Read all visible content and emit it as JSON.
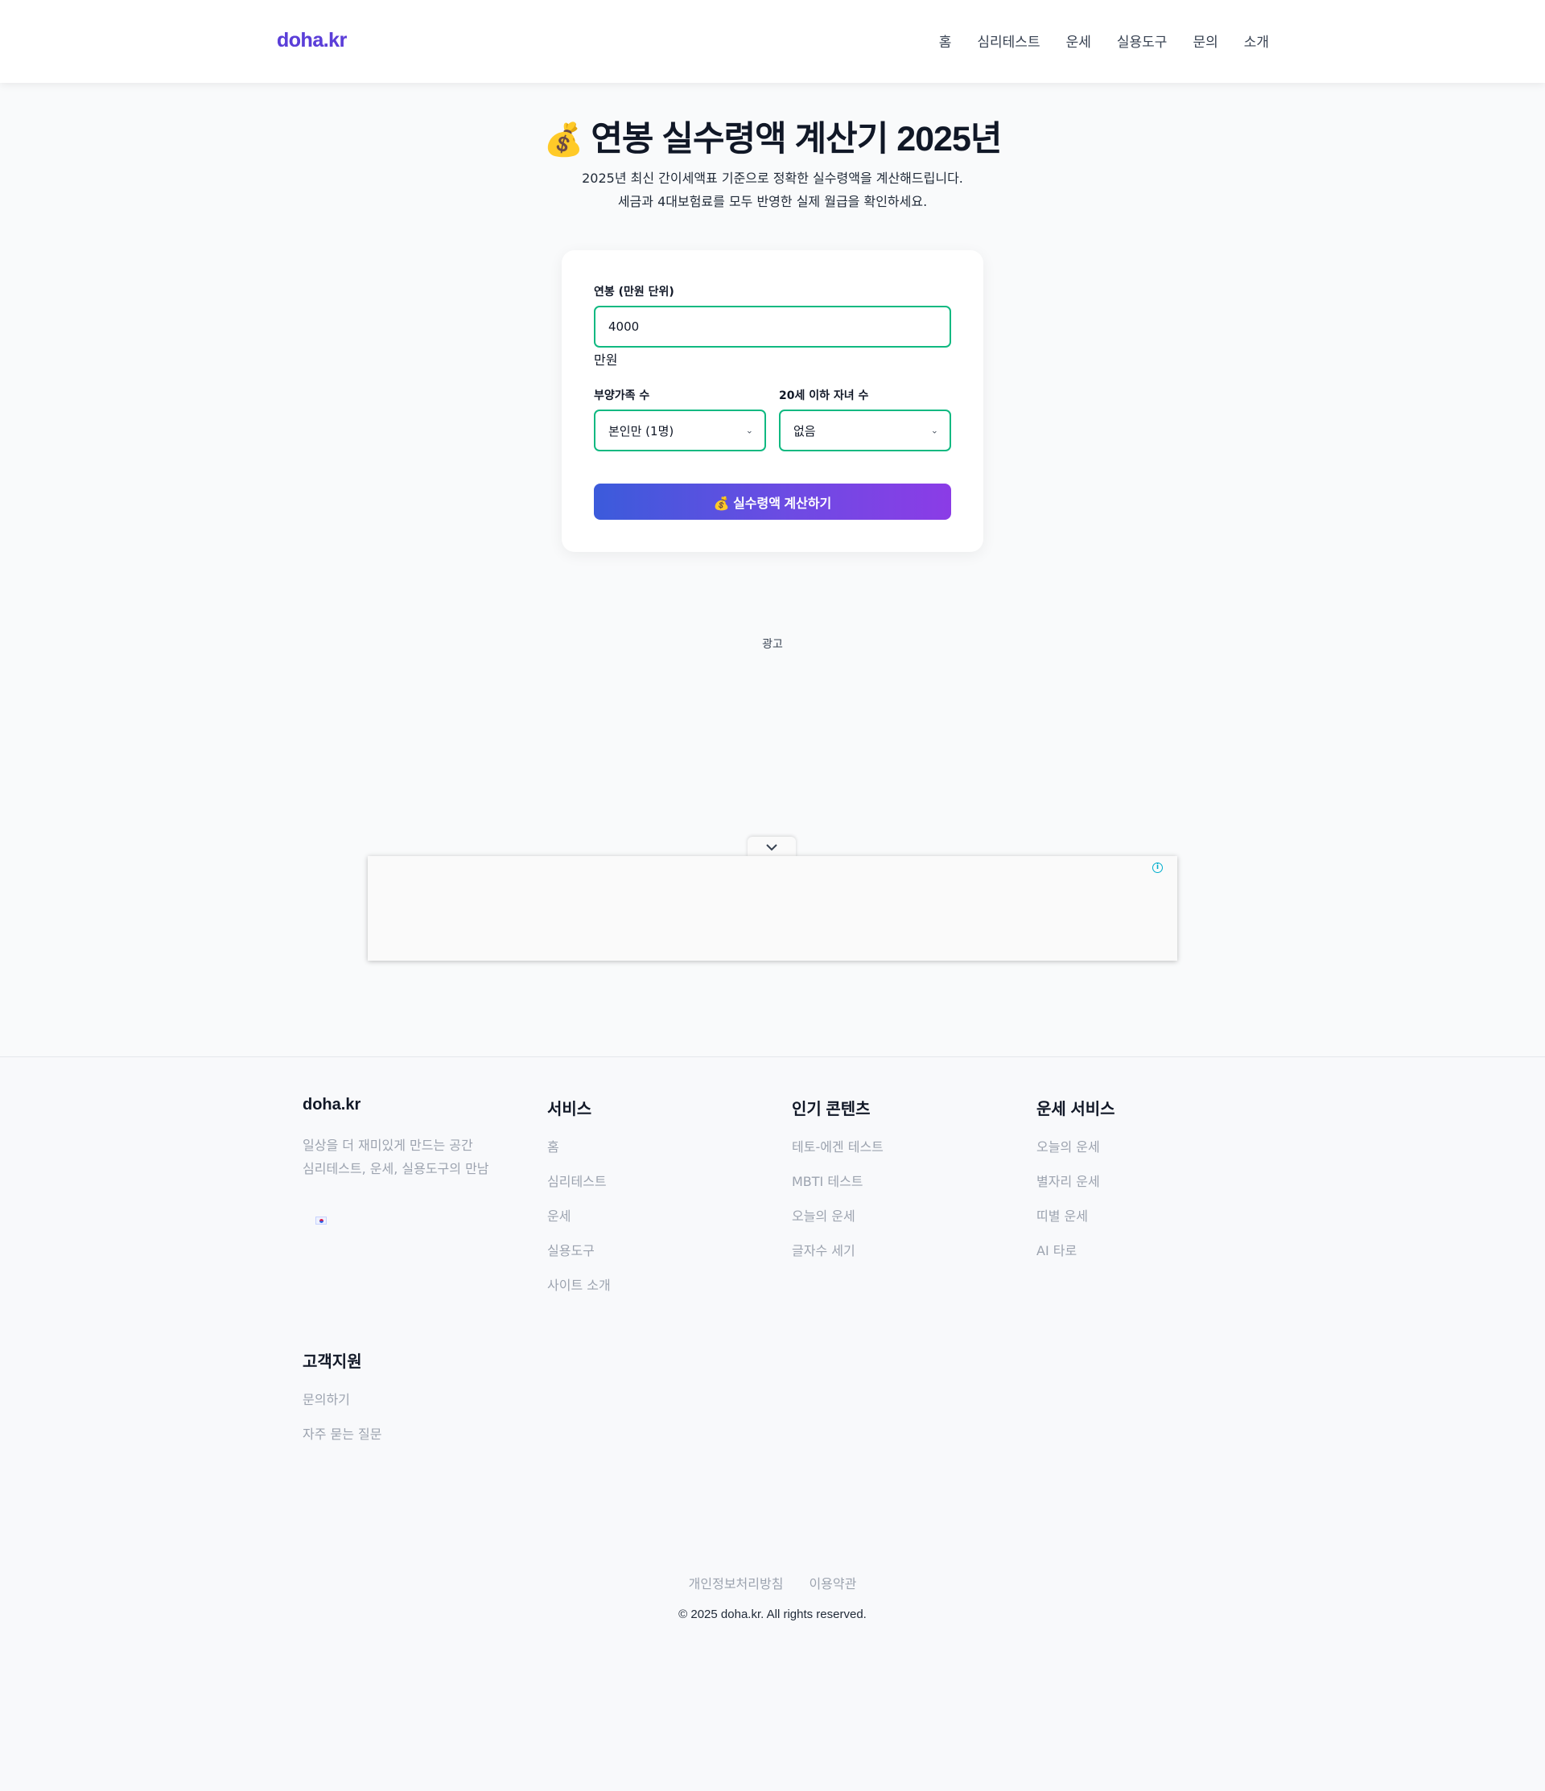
{
  "header": {
    "logo": "doha.kr",
    "nav": [
      "홈",
      "심리테스트",
      "운세",
      "실용도구",
      "문의",
      "소개"
    ]
  },
  "hero": {
    "emoji": "💰",
    "title": "연봉 실수령액 계산기 2025년",
    "subtitle_line1": "2025년 최신 간이세액표 기준으로 정확한 실수령액을 계산해드립니다.",
    "subtitle_line2": "세금과 4대보험료를 모두 반영한 실제 월급을 확인하세요."
  },
  "form": {
    "salary_label": "연봉 (만원 단위)",
    "salary_value": "4000",
    "salary_unit": "만원",
    "dependents_label": "부양가족 수",
    "dependents_value": "본인만 (1명)",
    "children_label": "20세 이하 자녀 수",
    "children_value": "없음",
    "calc_button": "💰 실수령액 계산하기"
  },
  "ad": {
    "label": "광고",
    "info_icon": "info-icon",
    "collapse_icon": "chevron-down-icon"
  },
  "footer": {
    "brand": {
      "title": "doha.kr",
      "desc_line1": "일상을 더 재미있게 만드는 공간",
      "desc_line2": "심리테스트, 운세, 실용도구의 만남"
    },
    "services": {
      "title": "서비스",
      "links": [
        "홈",
        "심리테스트",
        "운세",
        "실용도구",
        "사이트 소개"
      ]
    },
    "popular": {
      "title": "인기 콘텐츠",
      "links": [
        "테토-에겐 테스트",
        "MBTI 테스트",
        "오늘의 운세",
        "글자수 세기"
      ]
    },
    "fortune": {
      "title": "운세 서비스",
      "links": [
        "오늘의 운세",
        "별자리 운세",
        "띠별 운세",
        "AI 타로"
      ]
    },
    "support": {
      "title": "고객지원",
      "links": [
        "문의하기",
        "자주 묻는 질문"
      ]
    },
    "bottom_links": [
      "개인정보처리방침",
      "이용약관"
    ],
    "copyright": "© 2025 doha.kr. All rights reserved."
  },
  "colors": {
    "accent_green": "#10b981",
    "button_gradient_start": "#3b5bdb",
    "button_gradient_end": "#8b3ce6",
    "logo": "#5b3fd8"
  }
}
